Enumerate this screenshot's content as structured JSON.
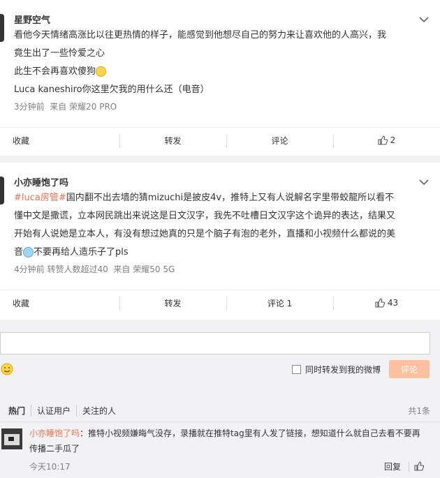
{
  "post1": {
    "author": "星野空气",
    "lines": [
      "看他今天情绪高涨比以往更热情的样子，能感觉到他想尽自己的努力来让喜欢他的人高兴，我",
      "竟生出了一些怜爱之心",
      "此生不会再喜欢傻狗",
      "Luca kaneshiro你这里欠我的用什么还（电音）"
    ],
    "time": "3分钟前",
    "source_prefix": "来自",
    "source": "荣耀20 PRO",
    "actions": {
      "favorite": "收藏",
      "repost": "转发",
      "comment": "评论",
      "like_count": "2"
    }
  },
  "post2": {
    "author": "小亦睡饱了吗",
    "topic": "#luca房管#",
    "line1": "国内翻不出去墙的猜mizuchi是披皮4v，推特上又有人说解名字里带蛟龍所以看不",
    "line2": "懂中文是撒谎，立本网民跳出来说这是日文汉字，我先不吐槽日文汉字这个诡异的表达，结果又",
    "line3": "开始有人说她是立本人，有没有想过她真的只是个脑子有泡的老外，直播和小视频什么都说的美",
    "line4_a": "音",
    "line4_b": "不要再给人造乐子了pls",
    "time": "4分钟前",
    "likers": "转赞人数超过40",
    "source_prefix": "来自",
    "source": "荣耀50 5G",
    "actions": {
      "favorite": "收藏",
      "repost": "转发",
      "comment": "评论 1",
      "like_count": "43"
    }
  },
  "comment_box": {
    "forward_label": "同时转发到我的微博",
    "submit_label": "评论"
  },
  "comments_section": {
    "tabs": [
      "热门",
      "认证用户",
      "关注的人"
    ],
    "count": "共1条",
    "items": [
      {
        "name": "小亦睡饱了吗",
        "text": "：推特小视频嫌晦气没存，录播就在推特tag里有人发了链接，想知道什么就自己去看不要再传播二手瓜了",
        "time": "今天10:17",
        "reply": "回复"
      }
    ]
  }
}
